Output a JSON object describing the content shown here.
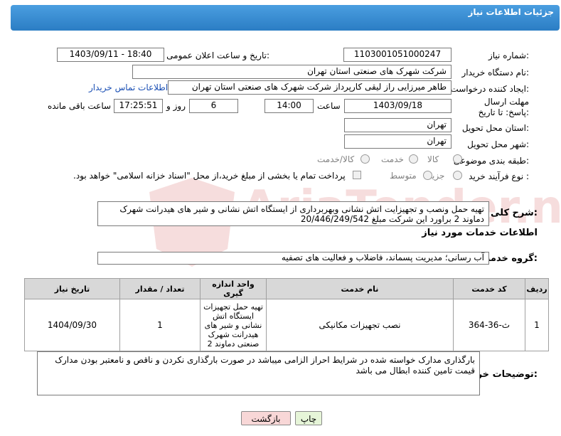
{
  "header": {
    "title": "جزئیات اطلاعات نیاز"
  },
  "labels": {
    "need_number": "شماره نیاز:",
    "announce_datetime": "تاریخ و ساعت اعلان عمومی:",
    "buyer_org": "نام دستگاه خریدار:",
    "requester": "ایجاد کننده درخواست:",
    "reply_deadline": "مهلت ارسال پاسخ: تا تاریخ:",
    "time_word": "ساعت",
    "days_and": "روز و",
    "remaining": "ساعت باقی مانده",
    "province": "استان محل تحویل:",
    "city": "شهر محل تحویل:",
    "category": "طبقه بندی موضوعی:",
    "purchase_type": "نوع فرآیند خرید :",
    "description": "شرح کلی نیاز:",
    "services_heading": "اطلاعات خدمات مورد نیاز",
    "service_group": "گروه خدمت:",
    "buyer_notes": "توضیحات خریدار:"
  },
  "values": {
    "need_number": "1103001051000247",
    "announce_datetime": "1403/09/11 - 18:40",
    "buyer_org": "شرکت شهرک های صنعتی استان تهران",
    "requester": "طاهر  میرزایی راز لیقی کارپرداز شرکت شهرک های صنعتی استان تهران",
    "contact_link": "اطلاعات تماس خریدار",
    "deadline_date": "1403/09/18",
    "deadline_time": "14:00",
    "days": "6",
    "remaining_time": "17:25:51",
    "province": "تهران",
    "city": "تهران",
    "description": "تهیه حمل ونصب و تجهیزایت اتش نشانی وبهربرداری از ایستگاه اتش نشانی و شیر های هیدرانت شهرک دماوند 2 براورد این شرکت مبلغ 20/446/249/542",
    "service_group": "آب رسانی؛ مدیریت پسماند، فاضلاب و فعالیت های تصفیه",
    "buyer_notes": "بارگذاری مدارک خواسته شده در شرایط احراز الزامی میباشد در صورت بارگذاری نکردن و ناقص و نامعتبر بودن مدارک قیمت تامین کننده ابطال می باشد"
  },
  "category_options": [
    "کالا",
    "خدمت",
    "کالا/خدمت"
  ],
  "purchase_options": [
    "جزیی",
    "متوسط"
  ],
  "purchase_note": "پرداخت تمام یا بخشی از مبلغ خرید،از محل \"اسناد خزانه اسلامی\" خواهد بود.",
  "table": {
    "headers": [
      "ردیف",
      "کد خدمت",
      "نام خدمت",
      "واحد اندازه گیری",
      "تعداد / مقدار",
      "تاریخ نیاز"
    ],
    "rows": [
      [
        "1",
        "ث-36-364",
        "نصب تجهیزات مکانیکی",
        "تهیه حمل تجهیزات ایستگاه اتش نشانی و شیر های هیدرانت شهرک صنعتی دماوند 2",
        "1",
        "1404/09/30"
      ]
    ]
  },
  "buttons": {
    "print": "چاپ",
    "back": "بازگشت"
  },
  "watermark": "AriaTender.neT",
  "colors": {
    "header": "#2b7dc4",
    "back_button": "#f8d7d7",
    "print_button": "#e6f5d8",
    "link": "#1a4fb4"
  }
}
